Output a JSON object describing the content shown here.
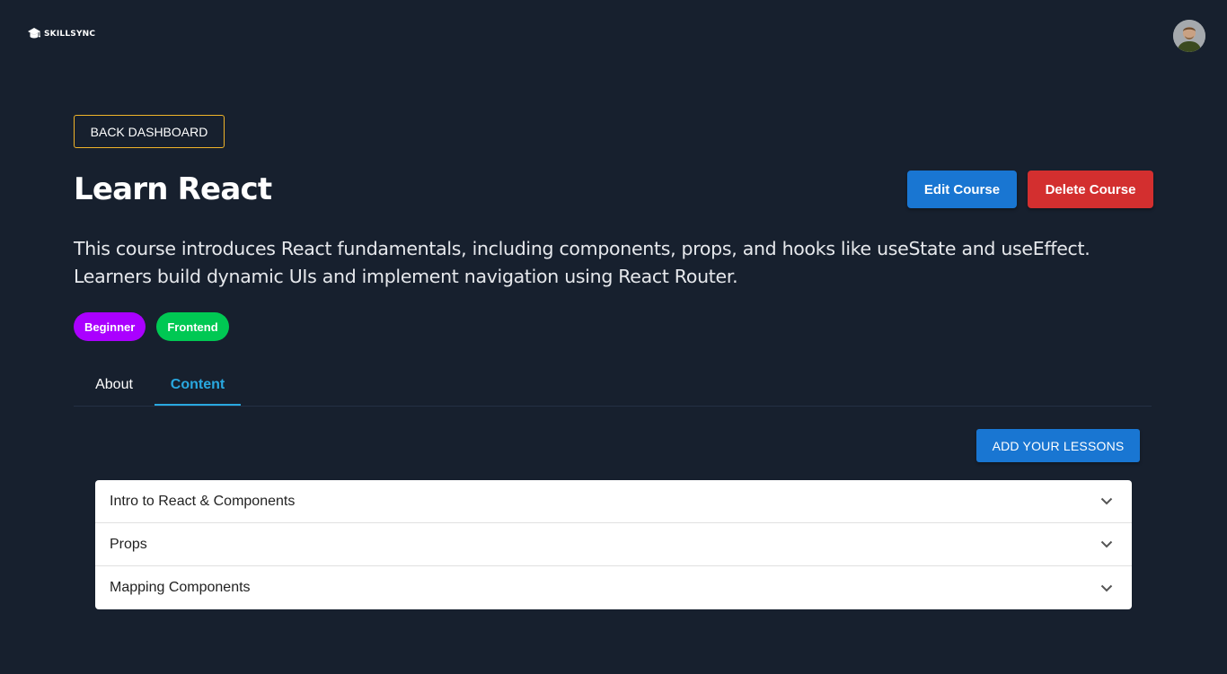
{
  "header": {
    "logo_text": "SKILLSYNC",
    "logo_icon": "graduation-cap-icon",
    "avatar": "user-avatar"
  },
  "nav": {
    "back_label": "BACK DASHBOARD"
  },
  "course": {
    "title": "Learn React",
    "description": "This course introduces React fundamentals, including components, props, and hooks like useState and useEffect. Learners build dynamic UIs and implement navigation using React Router.",
    "tags": [
      {
        "label": "Beginner",
        "color": "#aa00ff"
      },
      {
        "label": "Frontend",
        "color": "#00c853"
      }
    ]
  },
  "actions": {
    "edit_label": "Edit Course",
    "delete_label": "Delete Course",
    "edit_color": "#1976d2",
    "delete_color": "#d32f2f"
  },
  "tabs": [
    {
      "label": "About",
      "active": false
    },
    {
      "label": "Content",
      "active": true
    }
  ],
  "content": {
    "add_lessons_label": "ADD YOUR LESSONS",
    "lessons": [
      {
        "title": "Intro to React & Components",
        "icon": "chevron-down-icon"
      },
      {
        "title": "Props",
        "icon": "chevron-down-icon"
      },
      {
        "title": "Mapping Components",
        "icon": "chevron-down-icon"
      }
    ]
  },
  "colors": {
    "background": "#17202e",
    "accent": "#29a8e0",
    "back_border": "#f0b429"
  }
}
